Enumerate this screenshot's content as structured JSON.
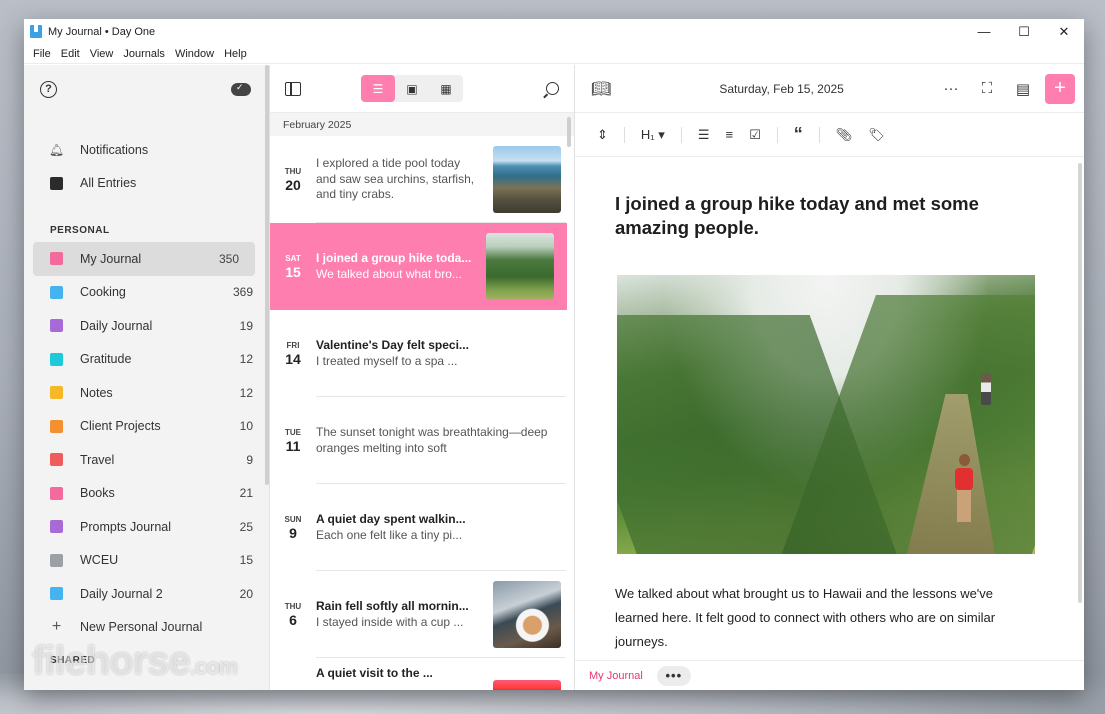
{
  "window": {
    "title": "My Journal • Day One",
    "controls": [
      "—",
      "☐",
      "✕"
    ]
  },
  "menu": [
    "File",
    "Edit",
    "View",
    "Journals",
    "Window",
    "Help"
  ],
  "sidebar": {
    "top_items": [
      {
        "label": "Notifications",
        "icon": "bell-icon"
      },
      {
        "label": "All Entries",
        "color": "#2b2b2b"
      }
    ],
    "personal_header": "PERSONAL",
    "journals": [
      {
        "label": "My Journal",
        "count": "350",
        "color": "#f26b9c"
      },
      {
        "label": "Cooking",
        "count": "369",
        "color": "#44b3f0"
      },
      {
        "label": "Daily Journal",
        "count": "19",
        "color": "#a86ad6"
      },
      {
        "label": "Gratitude",
        "count": "12",
        "color": "#1ec9d8"
      },
      {
        "label": "Notes",
        "count": "12",
        "color": "#f5b928"
      },
      {
        "label": "Client Projects",
        "count": "10",
        "color": "#f5902e"
      },
      {
        "label": "Travel",
        "count": "9",
        "color": "#f05c5c"
      },
      {
        "label": "Books",
        "count": "21",
        "color": "#f26b9c"
      },
      {
        "label": "Prompts Journal",
        "count": "25",
        "color": "#a86ad6"
      },
      {
        "label": "WCEU",
        "count": "15",
        "color": "#9aa0a6"
      },
      {
        "label": "Daily Journal 2",
        "count": "20",
        "color": "#44b3f0"
      }
    ],
    "new_journal": "New Personal Journal",
    "shared_header": "SHARED",
    "watermark": "filehorse",
    "watermark_suffix": ".com"
  },
  "entries": {
    "month": "February 2025",
    "items": [
      {
        "dow": "THU",
        "day": "20",
        "title": "",
        "body": "I explored a tide pool today and saw sea urchins, starfish, and tiny crabs.",
        "thumb": "tidepool"
      },
      {
        "dow": "SAT",
        "day": "15",
        "title": "I joined a group hike toda...",
        "body": "We talked about what bro...",
        "thumb": "valley",
        "selected": true
      },
      {
        "dow": "FRI",
        "day": "14",
        "title": "Valentine's Day felt speci...",
        "body": "I treated myself to a spa ...",
        "thumb": ""
      },
      {
        "dow": "TUE",
        "day": "11",
        "title": "",
        "body": "The sunset tonight was breathtaking—deep oranges melting into soft",
        "thumb": ""
      },
      {
        "dow": "SUN",
        "day": "9",
        "title": "A quiet day spent walkin...",
        "body": "Each one felt like a tiny pi...",
        "thumb": ""
      },
      {
        "dow": "THU",
        "day": "6",
        "title": "Rain fell softly all mornin...",
        "body": "I stayed inside with a cup ...",
        "thumb": "coffee"
      },
      {
        "dow": "",
        "day": "",
        "title": "A quiet visit to the ...",
        "body": "",
        "thumb": "sunset"
      }
    ]
  },
  "editor": {
    "date": "Saturday, Feb 15, 2025",
    "heading_label": "H₁",
    "title": "I joined a group hike today and met some amazing people.",
    "paragraph": "We talked about what brought us to Hawaii and the lessons we've learned here. It felt good to connect with others who are on similar journeys.",
    "journal_tag": "My Journal",
    "more": "•••"
  },
  "colors": {
    "accent": "#ff7eb0",
    "tag": "#e8366f"
  }
}
